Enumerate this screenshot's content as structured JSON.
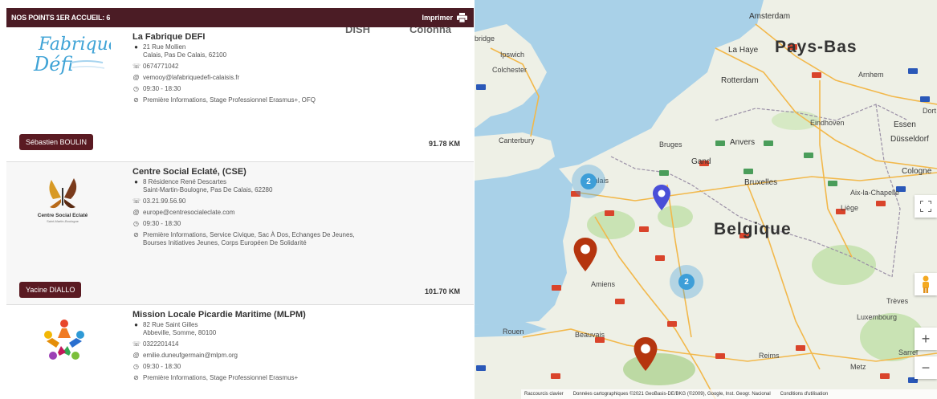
{
  "header": {
    "title": "NOS POINTS 1ER ACCUEIL: 6",
    "print_label": "Imprimer"
  },
  "ghost_headers": [
    "DISH",
    "Colonna"
  ],
  "points": [
    {
      "name": "La Fabrique DEFI",
      "logo_text": "Fabrique Défi",
      "address": "21 Rue Mollien",
      "city": "Calais, Pas De Calais, 62100",
      "phone": "0674771042",
      "email": "vemooy@lafabriquedefi-calaisis.fr",
      "hours": "09:30 - 18:30",
      "services": "Première Informations, Stage Professionnel Erasmus+, OFQ",
      "advisor": "Sébastien BOULIN",
      "distance": "91.78 KM"
    },
    {
      "name": "Centre Social Eclaté, (CSE)",
      "logo_text": "Centre Social Eclaté",
      "logo_sub": "Saint-Martin-Boulogne",
      "address": "8 Résidence René Descartes",
      "city": "Saint-Martin-Boulogne, Pas De Calais, 62280",
      "phone": "03.21.99.56.90",
      "email": "europe@centresocialeclate.com",
      "hours": "09:30 - 18:30",
      "services": "Première Informations, Service Civique, Sac À Dos, Echanges De Jeunes, Bourses Initiatives Jeunes, Corps Européen De Solidarité",
      "advisor": "Yacine DIALLO",
      "distance": "101.70 KM"
    },
    {
      "name": "Mission Locale Picardie Maritime (MLPM)",
      "address": "82 Rue Saint Gilles",
      "city": "Abbeville, Somme, 80100",
      "phone": "0322201414",
      "email": "emilie.duneufgermain@mlpm.org",
      "hours": "09:30 - 18:30",
      "services": "Première Informations, Stage Professionnel Erasmus+"
    }
  ],
  "map": {
    "labels": {
      "amsterdam": "Amsterdam",
      "pays_bas": "Pays-Bas",
      "la_haye": "La Haye",
      "rotterdam": "Rotterdam",
      "ipswich": "Ipswich",
      "colchester": "Colchester",
      "eindhoven": "Eindhoven",
      "essen": "Essen",
      "dusseldorf": "Düsseldorf",
      "dort": "Dort",
      "anvers": "Anvers",
      "bruges": "Bruges",
      "gand": "Gand",
      "bruxelles": "Bruxelles",
      "cologne": "Cologne",
      "liege": "Liège",
      "aix": "Aix-la-Chapelle",
      "belgique": "Belgique",
      "canterbury": "Canterbury",
      "calais": "Calais",
      "amiens": "Amiens",
      "rouen": "Rouen",
      "beauvais": "Beauvais",
      "reims": "Reims",
      "metz": "Metz",
      "luxembourg": "Luxembourg",
      "treves": "Trèves",
      "sarre": "Sarrel",
      "bridge": "bridge",
      "arnhem": "Arnhem"
    },
    "clusters": [
      "2",
      "2"
    ],
    "attribution": [
      "Raccourcis clavier",
      "Données cartographiques ©2021 GeoBasis-DE/BKG (©2009), Google, Inst. Geogr. Nacional",
      "Conditions d'utilisation"
    ],
    "zoom_in": "+",
    "zoom_out": "−",
    "colors": {
      "water": "#a9d1e8",
      "land": "#eef0e6",
      "pin_red": "#b5350f",
      "pin_blue": "#4a4fd8",
      "cluster": "#3d9ed8",
      "header_bg": "#4b1c25"
    }
  }
}
